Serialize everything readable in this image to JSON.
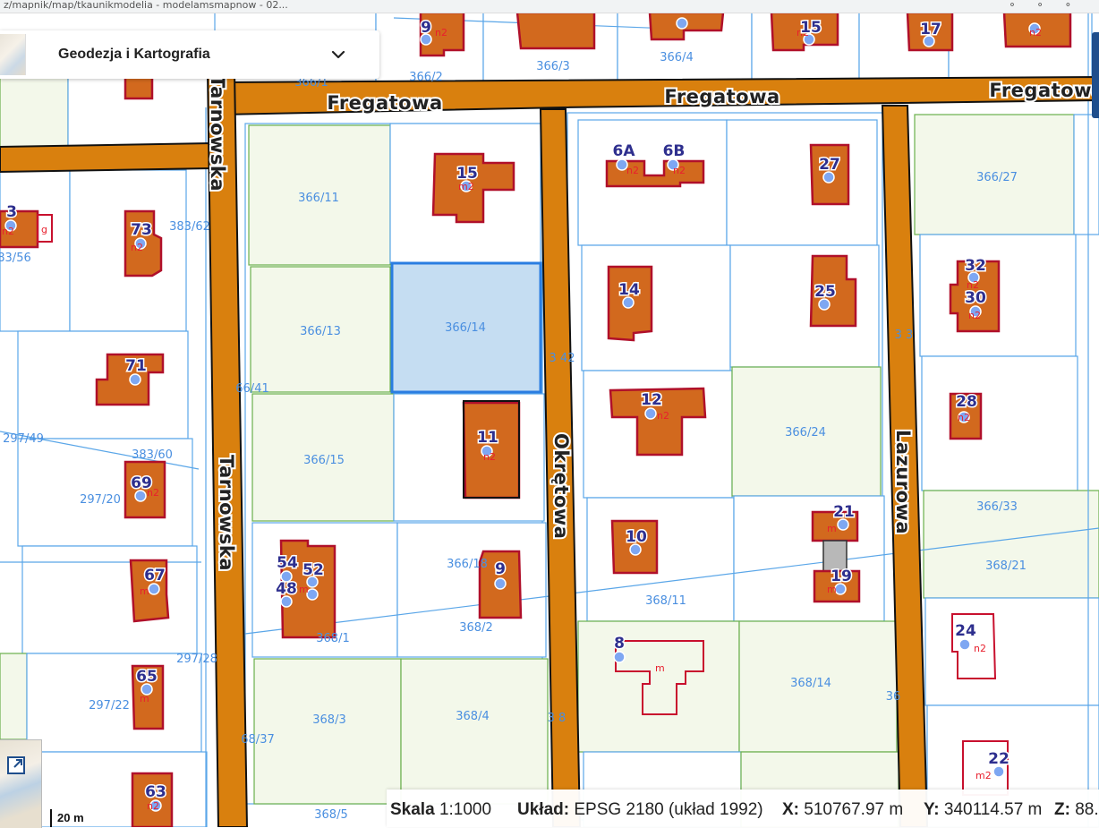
{
  "browser": {
    "url_text": "z/mapnik/map/tkaunikmodelia - modelamsmapnow - 02..."
  },
  "layer_panel": {
    "title": "Geodezja i Kartografia",
    "thumbnail_icon": "map-thumbnail-icon",
    "chevron_icon": "chevron-down-icon"
  },
  "map": {
    "streets": {
      "fregatowa_1": "Fregatowa",
      "fregatowa_2": "Fregatowa",
      "fregatowa_3": "Fregatowa",
      "tarnowska_top": "Tarnowska",
      "tarnowska_bottom": "Tarnowska",
      "okretowa": "Okrętowa",
      "lazurowa": "Lazurowa"
    },
    "parcel_ids": {
      "p366_2": "366/2",
      "p366_3": "366/3",
      "p366_4": "366/4",
      "p366_1": "366/1",
      "p366_11": "366/11",
      "p366_13": "366/13",
      "p366_14": "366/14",
      "p366_15": "366/15",
      "p366_18": "366/18",
      "p366_41": "66/41",
      "p366_42": "3  42",
      "p366_24": "366/24",
      "p366_27": "366/27",
      "p366_33": "366/33",
      "p383_62": "383/62",
      "p383_56": "83/56",
      "p383_60": "383/60",
      "p297_49": "297/49",
      "p297_20": "297/20",
      "p297_28": "297/28",
      "p297_22": "297/22",
      "p368_1": "368/1",
      "p368_2": "368/2",
      "p368_3": "368/3",
      "p368_4": "368/4",
      "p368_5": "368/5",
      "p368_8": "3  8",
      "p368_11": "368/11",
      "p368_14": "368/14",
      "p368_21": "368/21",
      "p368_37": "68/37",
      "p366_3r": "3  3",
      "p36_r": "36"
    },
    "house_numbers": {
      "n9top": "9",
      "n15top": "15",
      "n17": "17",
      "n15": "15",
      "n6A": "6A",
      "n6B": "6B",
      "n27": "27",
      "n3": "3",
      "n73": "73",
      "n14": "14",
      "n25": "25",
      "n32": "32",
      "n30": "30",
      "n71": "71",
      "n12": "12",
      "n11": "11",
      "n28": "28",
      "n69": "69",
      "n21": "21",
      "n10": "10",
      "n54": "54",
      "n52": "52",
      "n48": "48",
      "n9": "9",
      "n19": "19",
      "n67": "67",
      "n8": "8",
      "n24": "24",
      "n65": "65",
      "n22": "22",
      "n63": "63"
    },
    "building_codes": {
      "n2": "n2",
      "m": "m",
      "g": "g",
      "m2": "m2"
    }
  },
  "minimap": {
    "expand_icon": "expand-icon"
  },
  "scale_bar": {
    "label": "20 m"
  },
  "statusbar": {
    "scale_label": "Skala",
    "scale_value": "1:1000",
    "crs_label": "Układ:",
    "crs_value": "EPSG 2180 (układ 1992)",
    "x_label": "X:",
    "x_value": "510767.97 m",
    "y_label": "Y:",
    "y_value": "340114.57 m",
    "z_label": "Z:",
    "z_value": "88."
  },
  "colors": {
    "road": "#d9800e",
    "building": "#d2691e",
    "building_stroke": "#b0102a",
    "parcel_line": "#5aa6e8",
    "parcel_green_line": "#6ab04c",
    "selected_parcel": "#c5ddf2",
    "house_number": "#2e2f8e",
    "panel_accent": "#1f4e8c"
  }
}
